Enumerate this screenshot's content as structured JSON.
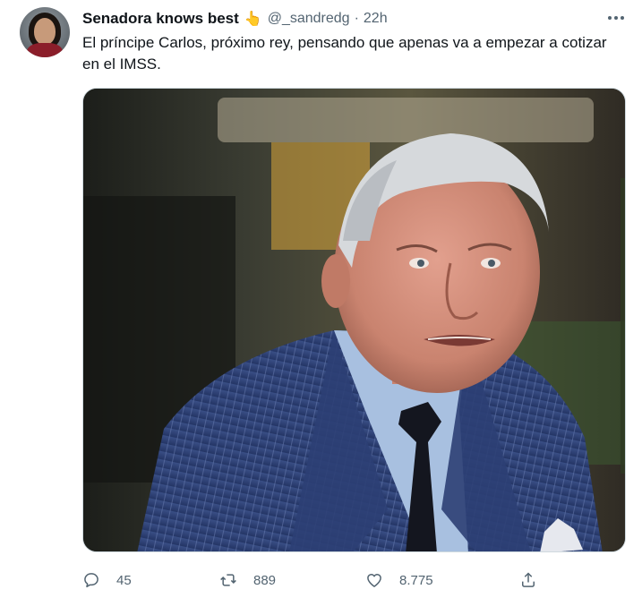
{
  "tweet": {
    "author_name": "Senadora knows best",
    "author_emoji": "👆",
    "handle": "@_sandredg",
    "separator": "·",
    "time": "22h",
    "text": "El príncipe Carlos, próximo rey, pensando que apenas va a empezar a cotizar en el IMSS.",
    "media_icon": "photo-of-man-in-pinstripe-suit",
    "more_icon": "more-horizontal-icon"
  },
  "actions": {
    "reply_count": "45",
    "retweet_count": "889",
    "like_count": "8.775",
    "reply_icon": "reply-icon",
    "retweet_icon": "retweet-icon",
    "like_icon": "heart-icon",
    "share_icon": "share-icon"
  },
  "colors": {
    "text_primary": "#0f1419",
    "text_secondary": "#536471",
    "border": "#cfd9de"
  }
}
